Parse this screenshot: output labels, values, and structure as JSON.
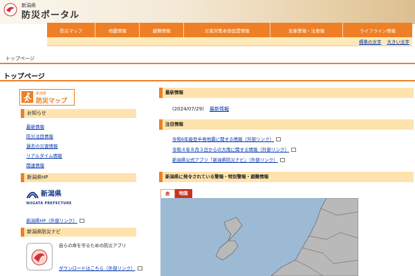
{
  "header": {
    "prefecture": "新潟県",
    "site_title": "防災ポータル"
  },
  "nav": {
    "items": [
      "防災マップ",
      "地震情報",
      "避難情報",
      "災害対策本部設置情報",
      "気象警報・注意報",
      "ライフライン情報"
    ]
  },
  "font_size": {
    "standard": "標準の文字",
    "large": "大きい文字"
  },
  "breadcrumb": "トップページ",
  "page_title": "トップページ",
  "sidebar": {
    "map_banner": {
      "sub": "新潟県",
      "main": "防災マップ"
    },
    "notice_heading": "お知らせ",
    "notice_links": [
      "最新情報",
      "防災注目情報",
      "過去の災害情報",
      "リアルタイム情報",
      "関連情報"
    ],
    "hp_heading": "新潟県HP",
    "niigata_logo": {
      "jp": "新潟県",
      "en": "NIIGATA PREFECTURE"
    },
    "hp_link": "新潟県HP（外部リンク）",
    "navi_heading": "新潟県防災ナビ",
    "app_desc": "自らの命を守るための防災アプリ",
    "app_download": "ダウンロードはこちら（外部リンク）"
  },
  "main": {
    "latest_heading": "最新情報",
    "latest_date": "(2024/07/29)",
    "latest_link": "最新情報",
    "attention_heading": "注目情報",
    "attention_links": [
      "令和6年能登半島地震に関する情報（外部リンク）",
      "令和４年８月３日からの大雨に関する情報（外部リンク）",
      "新潟県公式アプリ「新潟県防災ナビ」（外部リンク）"
    ],
    "warnings_heading": "新潟県に発令されている警報・特別警報・避難情報",
    "tabs": [
      "表",
      "地図"
    ]
  },
  "colors": {
    "accent_orange": "#ee7f27",
    "heading_bg": "#ffe3ad",
    "link": "#0033aa",
    "map_tab_active": "#c9341f",
    "sea": "#9dbad4",
    "land": "#b9b9b9"
  }
}
